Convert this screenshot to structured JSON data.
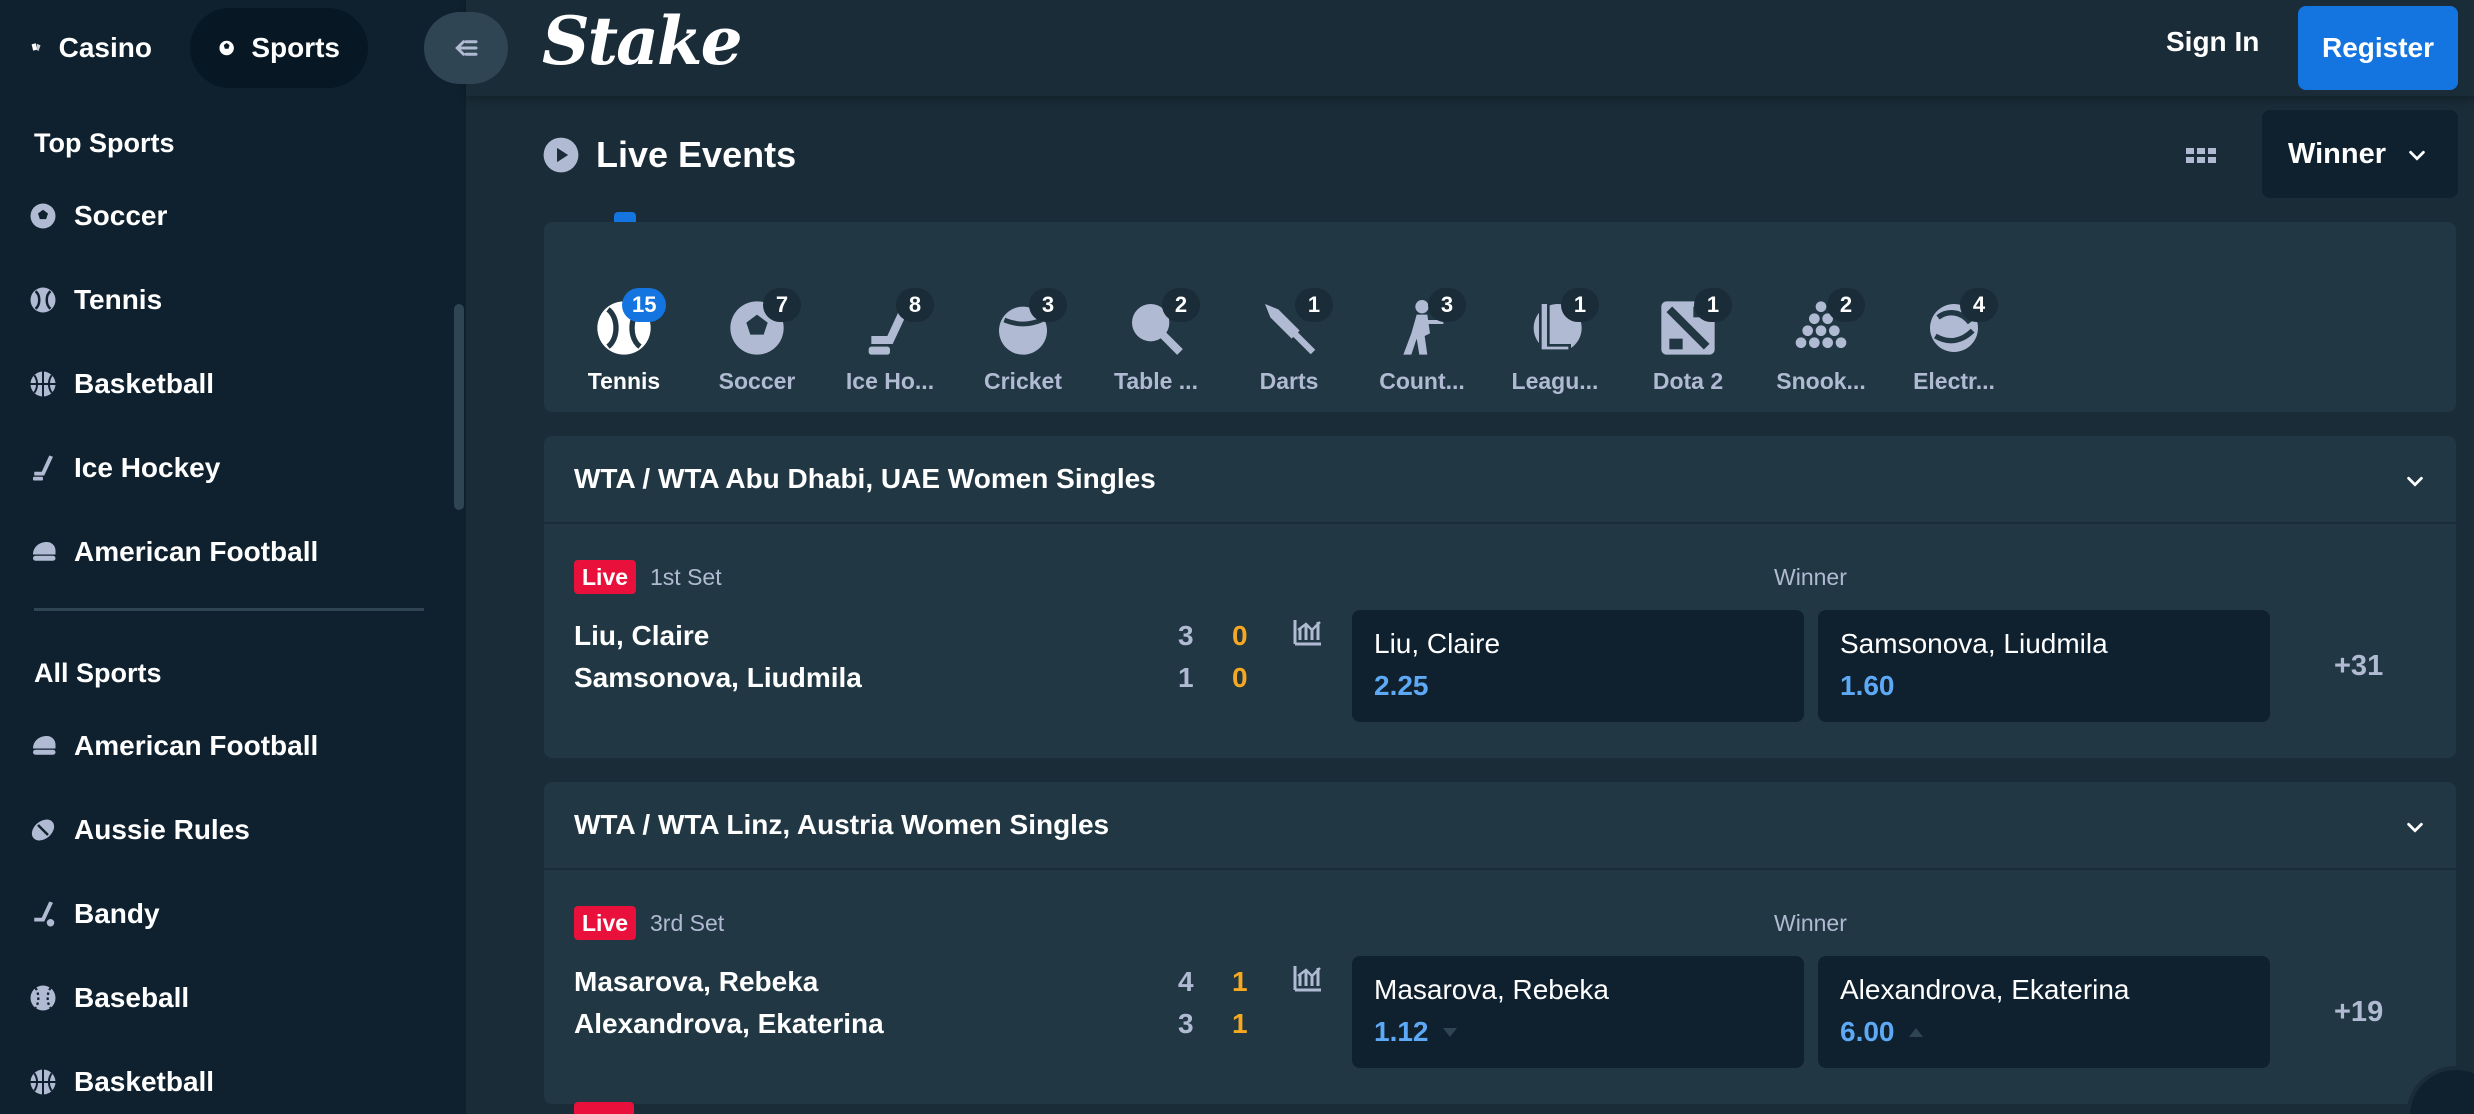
{
  "sidebar": {
    "tabs": {
      "casino": "Casino",
      "sports": "Sports"
    },
    "top_sports_title": "Top Sports",
    "top_sports": [
      {
        "label": "Soccer",
        "icon": "soccer-icon"
      },
      {
        "label": "Tennis",
        "icon": "tennis-icon"
      },
      {
        "label": "Basketball",
        "icon": "basketball-icon"
      },
      {
        "label": "Ice Hockey",
        "icon": "ice-hockey-icon"
      },
      {
        "label": "American Football",
        "icon": "american-football-icon"
      }
    ],
    "all_sports_title": "All Sports",
    "all_sports": [
      {
        "label": "American Football",
        "icon": "american-football-icon"
      },
      {
        "label": "Aussie Rules",
        "icon": "aussie-rules-icon"
      },
      {
        "label": "Bandy",
        "icon": "bandy-icon"
      },
      {
        "label": "Baseball",
        "icon": "baseball-icon"
      },
      {
        "label": "Basketball",
        "icon": "basketball-icon"
      }
    ]
  },
  "header": {
    "logo": "Stake",
    "sign_in": "Sign In",
    "register": "Register"
  },
  "main": {
    "title": "Live Events",
    "market_select": "Winner",
    "sports_strip": [
      {
        "label": "Tennis",
        "count": "15",
        "icon": "tennis-icon",
        "active": true
      },
      {
        "label": "Soccer",
        "count": "7",
        "icon": "soccer-icon"
      },
      {
        "label": "Ice Ho...",
        "count": "8",
        "icon": "ice-hockey-icon"
      },
      {
        "label": "Cricket",
        "count": "3",
        "icon": "cricket-icon"
      },
      {
        "label": "Table ...",
        "count": "2",
        "icon": "table-tennis-icon"
      },
      {
        "label": "Darts",
        "count": "1",
        "icon": "darts-icon"
      },
      {
        "label": "Count...",
        "count": "3",
        "icon": "counter-strike-icon"
      },
      {
        "label": "Leagu...",
        "count": "1",
        "icon": "league-of-legends-icon"
      },
      {
        "label": "Dota 2",
        "count": "1",
        "icon": "dota-2-icon"
      },
      {
        "label": "Snook...",
        "count": "2",
        "icon": "snooker-icon"
      },
      {
        "label": "Electr...",
        "count": "4",
        "icon": "electronic-icon"
      }
    ],
    "events": [
      {
        "tournament": "WTA / WTA Abu Dhabi, UAE Women Singles",
        "live": "Live",
        "set": "1st Set",
        "market": "Winner",
        "home": {
          "name": "Liu, Claire",
          "sets": "3",
          "games": "0"
        },
        "away": {
          "name": "Samsonova, Liudmila",
          "sets": "1",
          "games": "0"
        },
        "odds": [
          {
            "name": "Liu, Claire",
            "price": "2.25"
          },
          {
            "name": "Samsonova, Liudmila",
            "price": "1.60"
          }
        ],
        "more": "+31"
      },
      {
        "tournament": "WTA / WTA Linz, Austria Women Singles",
        "live": "Live",
        "set": "3rd Set",
        "market": "Winner",
        "home": {
          "name": "Masarova, Rebeka",
          "sets": "4",
          "games": "1"
        },
        "away": {
          "name": "Alexandrova, Ekaterina",
          "sets": "3",
          "games": "1"
        },
        "odds": [
          {
            "name": "Masarova, Rebeka",
            "price": "1.12",
            "trend": "down"
          },
          {
            "name": "Alexandrova, Ekaterina",
            "price": "6.00",
            "trend": "up"
          }
        ],
        "more": "+19"
      }
    ]
  },
  "colors": {
    "background": "#1a2c38",
    "sidebar": "#0f212e",
    "panel": "#213743",
    "accent": "#1475e1",
    "live": "#e9113c",
    "odds": "#5da9f6",
    "score_games": "#f6a821",
    "muted_text": "#b1bad3"
  }
}
